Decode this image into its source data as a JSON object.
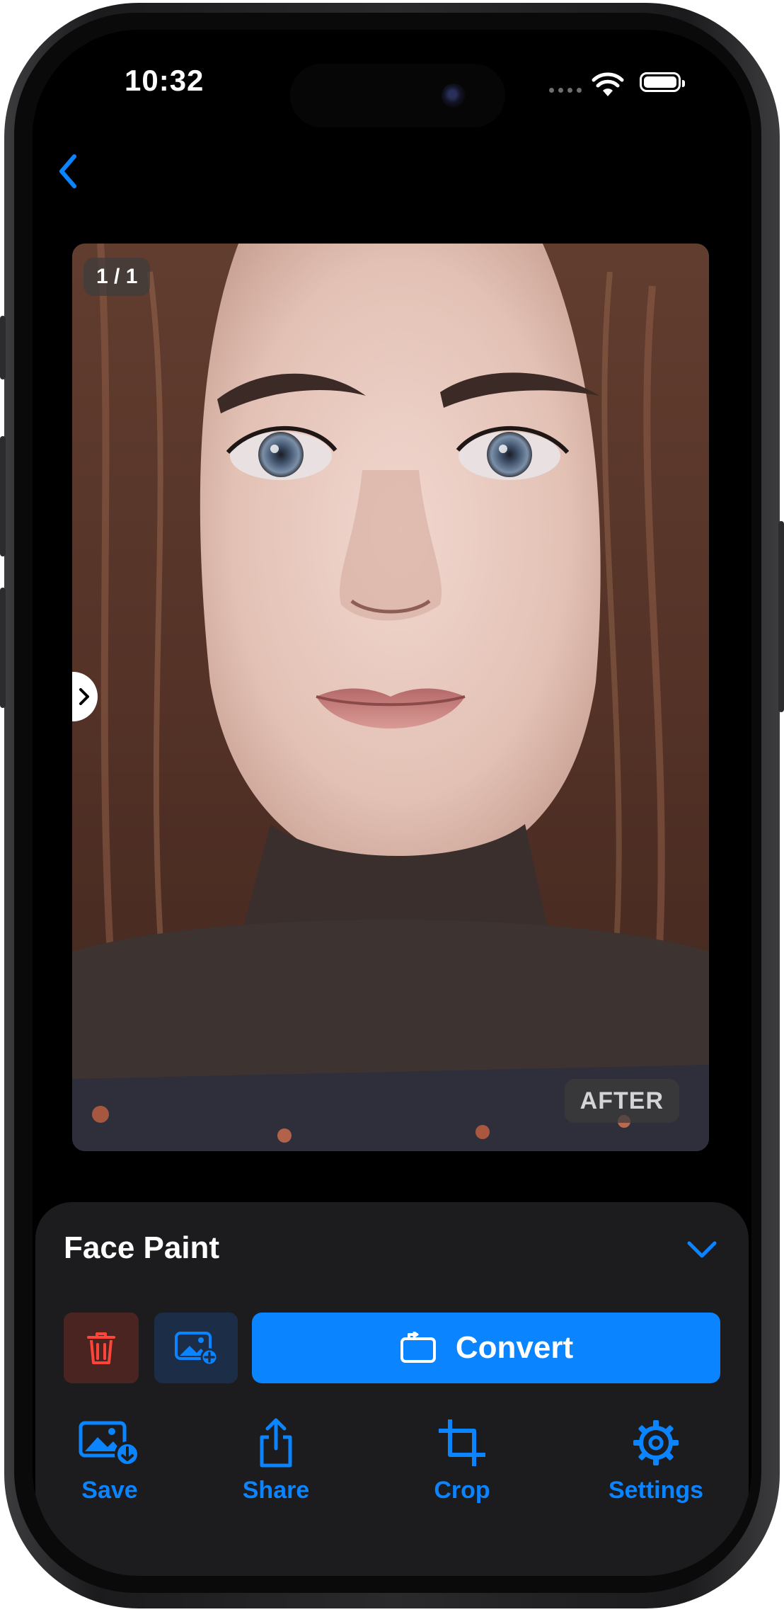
{
  "status_bar": {
    "time": "10:32"
  },
  "viewer": {
    "page_indicator": "1 / 1",
    "state_label": "AFTER"
  },
  "panel": {
    "effect_name": "Face Paint",
    "convert_label": "Convert"
  },
  "tabs": [
    {
      "label": "Save",
      "icon": "save-photo-icon"
    },
    {
      "label": "Share",
      "icon": "share-icon"
    },
    {
      "label": "Crop",
      "icon": "crop-icon"
    },
    {
      "label": "Settings",
      "icon": "gear-icon"
    }
  ],
  "colors": {
    "accent": "#0a84ff",
    "destructive": "#ff453a",
    "panel_bg": "#1c1c1e"
  }
}
